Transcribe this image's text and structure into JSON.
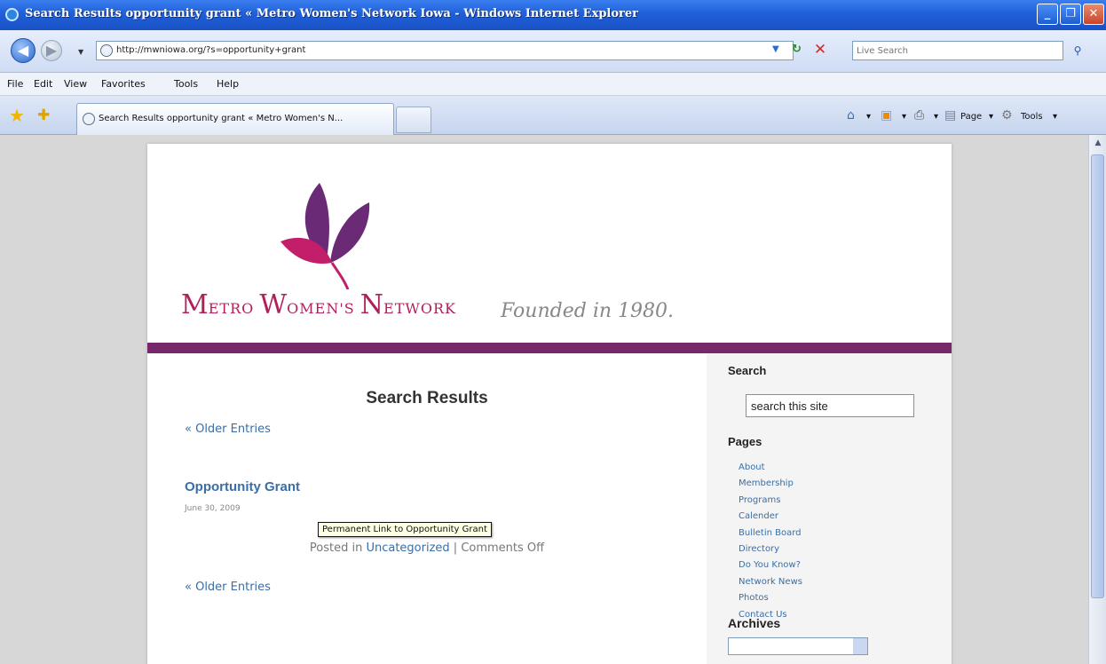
{
  "window": {
    "title": "Search Results opportunity grant « Metro Women's Network Iowa - Windows Internet Explorer",
    "minimize": "_",
    "restore": "❐",
    "close": "✕"
  },
  "addressbar": {
    "url": "http://mwniowa.org/?s=opportunity+grant",
    "search_placeholder": "Live Search",
    "back_symbol": "◀",
    "forward_symbol": "▶"
  },
  "menubar": {
    "items": [
      "File",
      "Edit",
      "View",
      "Favorites",
      "Tools",
      "Help"
    ]
  },
  "tabs": {
    "active_label": "Search Results opportunity grant « Metro Women's N...",
    "command_bar": {
      "page_label": "Page",
      "tools_label": "Tools"
    }
  },
  "site": {
    "logo_parts": {
      "m": "M",
      "etro": "ETRO ",
      "w": "W",
      "omens": "OMEN'S ",
      "n": "N",
      "etwork": "ETWORK"
    },
    "tagline": "Founded in 1980.",
    "colors": {
      "brand_magenta": "#b0215c",
      "brand_purple": "#76286a",
      "link": "#3a6ea5"
    }
  },
  "main": {
    "title": "Search Results",
    "older_entries_top": "« Older Entries",
    "post": {
      "title": "Opportunity Grant",
      "date": "June 30, 2009",
      "tooltip": "Permanent Link to Opportunity Grant",
      "posted_in_prefix": "Posted in ",
      "category": "Uncategorized",
      "separator": " | ",
      "comments": "Comments Off"
    },
    "older_entries_bottom": "« Older Entries"
  },
  "sidebar": {
    "search_heading": "Search",
    "search_value": "search this site",
    "pages_heading": "Pages",
    "pages": [
      "About",
      "Membership",
      "Programs",
      "Calender",
      "Bulletin Board",
      "Directory",
      "Do You Know?",
      "Network News",
      "Photos",
      "Contact Us"
    ],
    "archives_heading": "Archives"
  }
}
